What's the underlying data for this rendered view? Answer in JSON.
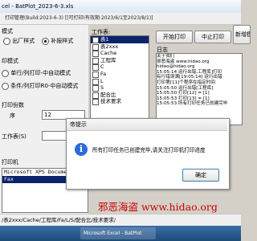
{
  "window": {
    "title": "cel - BatPlot_2023-6-3.xls"
  },
  "subbar": {
    "text": "打印管理(Build:2023-6-3)  [[可打印(有效期:2023/6/1至2023/8/1)]"
  },
  "left_panel": {
    "mode_label": "模式",
    "mode_options": [
      "出厂样式",
      "补报样式"
    ],
    "mode_selected": 1,
    "print_label": "印模式",
    "print_options": [
      "单行/列打印-中自动模式",
      "条件/列打印R0-中自动模式"
    ],
    "count_label": "打印份数",
    "order_label": "序",
    "order_value": "12",
    "sort_label": "工作表(S)",
    "printer_label": "打印机",
    "printers": [
      "Microsoft XPS Document W",
      "Fax"
    ]
  },
  "worksheet_list": {
    "label": "工作表:",
    "items": [
      "表1",
      "表2xxx",
      "Cache",
      "工程库",
      "C",
      "Fa",
      "L",
      "S",
      "配合比",
      "技术要求"
    ],
    "selected_index": 0
  },
  "buttons": {
    "start_print": "开始打印",
    "stop_print": "中止打印",
    "new_template": "新增模板"
  },
  "log": {
    "label": "日志",
    "lines": [
      "关于我们",
      "邪恶海盗 www.hidao.org",
      "hidao@hidao.org",
      "15:05:14 运行出错,工程库]打印",
      "有行错误满[19:05:14] 运行出错",
      "打印第[11]个程序在指定时间",
      "15:05:50 运行出错[工程库]",
      "15:05:50 打印[12] = [1]",
      "15:05:53 打印[13] = [1]",
      "",
      "15:05:53 所有打印任务已创建完毕"
    ]
  },
  "dialog": {
    "title": "帝提示",
    "message": "所有打印任务已创建完毕,请关注打印机打印进度",
    "ok_label": "确定"
  },
  "watermark": {
    "text": "邪恶海盗 www.hidao.org"
  },
  "sheet_tabs": {
    "text": "/表2xxx/Cache/工程库/Fa/L/S/配合比/技术要求/"
  },
  "taskbar": {
    "item": "Microsoft Excel - BatPlot"
  },
  "colors": {
    "selection": "#0a246a",
    "watermark": "#cc0000",
    "info_icon": "#2a6bd6"
  }
}
